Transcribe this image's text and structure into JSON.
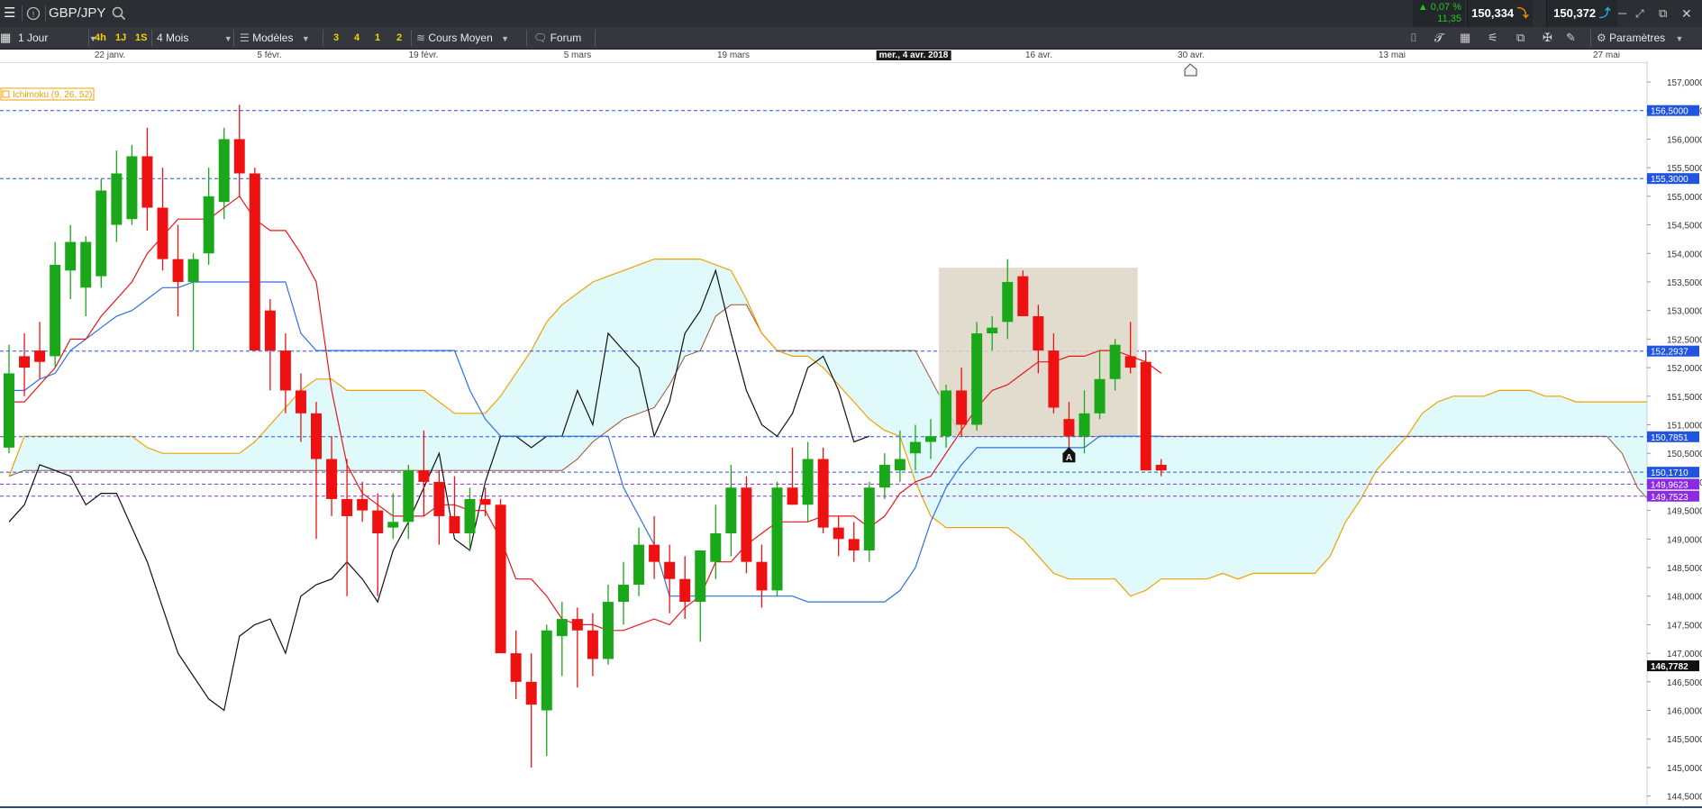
{
  "header": {
    "menu_icon": "hamburger-icon",
    "info_icon": "info-circle-icon",
    "instrument": "GBP/JPY",
    "search_icon": "search-icon",
    "change_pct": "▲ 0,07 %",
    "change_abs": "11,35",
    "sell_price": "150,334",
    "buy_price": "150,372",
    "window_icons": [
      "minimize-icon",
      "shrink-icon",
      "external-window-icon",
      "close-icon"
    ]
  },
  "toolbar": {
    "timeframe": "1 Jour",
    "intervals": [
      "4h",
      "1J",
      "1S"
    ],
    "period": "4 Mois",
    "models_label": "Modèles",
    "layouts": [
      "3",
      "4",
      "1",
      "2"
    ],
    "price_type": "Cours Moyen",
    "forum_label": "Forum",
    "settings_label": "Paramètres"
  },
  "colors": {
    "up": "#1aa81a",
    "down": "#ee1111",
    "tenkan": "#e8161b",
    "kijun": "#2f6fe0",
    "chikou": "#111111",
    "span_a": "#a0522d",
    "span_b": "#f0a000",
    "cloud": "#e0fafc",
    "hline": "#2255dd"
  },
  "chart_data": {
    "type": "candlestick",
    "indicator_label": "Ichimoku (9, 26, 52)",
    "date_labels": [
      "22 janv.",
      "5 févr.",
      "19 févr.",
      "5 mars",
      "19 mars",
      "mer., 4 avr. 2018",
      "16 avr.",
      "30 avr.",
      "13 mai",
      "27 mai"
    ],
    "ylim": [
      144.4,
      157.3
    ],
    "y_ticks": [
      "157,0000",
      "156,5000",
      "156,0000",
      "155,5000",
      "155,0000",
      "154,5000",
      "154,0000",
      "153,5000",
      "153,0000",
      "152,5000",
      "152,0000",
      "151,5000",
      "151,0000",
      "150,5000",
      "150,0000",
      "149,5000",
      "149,0000",
      "148,5000",
      "148,0000",
      "147,5000",
      "147,0000",
      "146,5000",
      "146,0000",
      "145,5000",
      "145,0000",
      "144,5000"
    ],
    "horizontal_levels": [
      {
        "value": 156.5,
        "label": "156,5000",
        "color": "#2255dd"
      },
      {
        "value": 155.31,
        "label": "155,3000",
        "color": "#2255dd"
      },
      {
        "value": 152.29,
        "label": "152,2937",
        "color": "#2255dd"
      },
      {
        "value": 150.79,
        "label": "150,7851",
        "color": "#2255dd"
      },
      {
        "value": 150.17,
        "label": "150,1710",
        "color": "#2255dd"
      },
      {
        "value": 149.96,
        "label": "149,9623",
        "color": "#8a2be2"
      },
      {
        "value": 149.75,
        "label": "149,7523",
        "color": "#8a2be2"
      }
    ],
    "current_price_label": "146,7782",
    "current_price": 146.78,
    "marker_label": "A",
    "candles": [
      {
        "o": 150.6,
        "h": 152.4,
        "l": 150.5,
        "c": 151.9
      },
      {
        "o": 152.2,
        "h": 152.6,
        "l": 151.5,
        "c": 152.0
      },
      {
        "o": 152.3,
        "h": 152.8,
        "l": 151.8,
        "c": 152.1
      },
      {
        "o": 152.2,
        "h": 154.2,
        "l": 152.0,
        "c": 153.8
      },
      {
        "o": 153.7,
        "h": 154.5,
        "l": 153.2,
        "c": 154.2
      },
      {
        "o": 153.4,
        "h": 154.3,
        "l": 152.9,
        "c": 154.2
      },
      {
        "o": 153.6,
        "h": 155.3,
        "l": 153.4,
        "c": 155.1
      },
      {
        "o": 154.5,
        "h": 155.8,
        "l": 154.2,
        "c": 155.4
      },
      {
        "o": 154.6,
        "h": 155.9,
        "l": 154.5,
        "c": 155.7
      },
      {
        "o": 155.7,
        "h": 156.2,
        "l": 154.4,
        "c": 154.8
      },
      {
        "o": 154.8,
        "h": 155.5,
        "l": 153.7,
        "c": 153.9
      },
      {
        "o": 153.9,
        "h": 154.5,
        "l": 152.9,
        "c": 153.5
      },
      {
        "o": 153.5,
        "h": 154.0,
        "l": 152.3,
        "c": 153.9
      },
      {
        "o": 154.0,
        "h": 155.5,
        "l": 153.8,
        "c": 155.0
      },
      {
        "o": 154.9,
        "h": 156.2,
        "l": 154.6,
        "c": 156.0
      },
      {
        "o": 156.0,
        "h": 156.6,
        "l": 155.0,
        "c": 155.4
      },
      {
        "o": 155.4,
        "h": 155.5,
        "l": 152.3,
        "c": 152.3
      },
      {
        "o": 153.0,
        "h": 153.2,
        "l": 151.6,
        "c": 152.3
      },
      {
        "o": 152.3,
        "h": 152.6,
        "l": 151.2,
        "c": 151.6
      },
      {
        "o": 151.6,
        "h": 151.9,
        "l": 150.7,
        "c": 151.2
      },
      {
        "o": 151.2,
        "h": 151.4,
        "l": 149.0,
        "c": 150.4
      },
      {
        "o": 150.4,
        "h": 150.8,
        "l": 149.4,
        "c": 149.7
      },
      {
        "o": 149.7,
        "h": 150.4,
        "l": 148.0,
        "c": 149.4
      },
      {
        "o": 149.7,
        "h": 150.0,
        "l": 149.3,
        "c": 149.5
      },
      {
        "o": 149.5,
        "h": 149.8,
        "l": 148.0,
        "c": 149.1
      },
      {
        "o": 149.2,
        "h": 149.8,
        "l": 149.0,
        "c": 149.3
      },
      {
        "o": 149.3,
        "h": 150.3,
        "l": 149.0,
        "c": 150.2
      },
      {
        "o": 150.2,
        "h": 150.9,
        "l": 149.4,
        "c": 150.0
      },
      {
        "o": 150.0,
        "h": 150.2,
        "l": 148.9,
        "c": 149.4
      },
      {
        "o": 149.4,
        "h": 150.1,
        "l": 149.3,
        "c": 149.1
      },
      {
        "o": 149.1,
        "h": 149.9,
        "l": 148.8,
        "c": 149.7
      },
      {
        "o": 149.7,
        "h": 149.9,
        "l": 149.4,
        "c": 149.6
      },
      {
        "o": 149.6,
        "h": 149.7,
        "l": 147.3,
        "c": 147.0
      },
      {
        "o": 147.0,
        "h": 147.4,
        "l": 146.2,
        "c": 146.5
      },
      {
        "o": 146.5,
        "h": 147.0,
        "l": 145.0,
        "c": 146.1
      },
      {
        "o": 146.0,
        "h": 147.5,
        "l": 145.2,
        "c": 147.4
      },
      {
        "o": 147.3,
        "h": 147.9,
        "l": 146.6,
        "c": 147.6
      },
      {
        "o": 147.6,
        "h": 147.8,
        "l": 146.4,
        "c": 147.4
      },
      {
        "o": 147.4,
        "h": 147.7,
        "l": 146.6,
        "c": 146.9
      },
      {
        "o": 146.9,
        "h": 148.2,
        "l": 146.8,
        "c": 147.9
      },
      {
        "o": 147.9,
        "h": 148.6,
        "l": 147.5,
        "c": 148.2
      },
      {
        "o": 148.2,
        "h": 149.2,
        "l": 148.0,
        "c": 148.9
      },
      {
        "o": 148.9,
        "h": 149.4,
        "l": 148.3,
        "c": 148.6
      },
      {
        "o": 148.6,
        "h": 148.9,
        "l": 147.7,
        "c": 148.3
      },
      {
        "o": 148.3,
        "h": 148.7,
        "l": 147.6,
        "c": 147.9
      },
      {
        "o": 147.9,
        "h": 148.8,
        "l": 147.2,
        "c": 148.8
      },
      {
        "o": 148.6,
        "h": 149.6,
        "l": 148.3,
        "c": 149.1
      },
      {
        "o": 149.1,
        "h": 150.3,
        "l": 148.7,
        "c": 149.9
      },
      {
        "o": 149.9,
        "h": 150.1,
        "l": 148.4,
        "c": 148.6
      },
      {
        "o": 148.6,
        "h": 148.9,
        "l": 147.8,
        "c": 148.1
      },
      {
        "o": 148.1,
        "h": 150.0,
        "l": 148.0,
        "c": 149.9
      },
      {
        "o": 149.9,
        "h": 150.6,
        "l": 149.6,
        "c": 149.6
      },
      {
        "o": 149.6,
        "h": 150.7,
        "l": 149.3,
        "c": 150.4
      },
      {
        "o": 150.4,
        "h": 150.6,
        "l": 149.1,
        "c": 149.2
      },
      {
        "o": 149.2,
        "h": 149.4,
        "l": 148.7,
        "c": 149.0
      },
      {
        "o": 149.0,
        "h": 149.3,
        "l": 148.6,
        "c": 148.8
      },
      {
        "o": 148.8,
        "h": 150.0,
        "l": 148.6,
        "c": 149.9
      },
      {
        "o": 149.9,
        "h": 150.5,
        "l": 149.7,
        "c": 150.3
      },
      {
        "o": 150.2,
        "h": 150.9,
        "l": 150.0,
        "c": 150.4
      },
      {
        "o": 150.5,
        "h": 151.0,
        "l": 150.2,
        "c": 150.7
      },
      {
        "o": 150.7,
        "h": 151.1,
        "l": 150.4,
        "c": 150.8
      },
      {
        "o": 150.8,
        "h": 151.7,
        "l": 150.6,
        "c": 151.6
      },
      {
        "o": 151.6,
        "h": 152.0,
        "l": 150.8,
        "c": 151.0
      },
      {
        "o": 151.0,
        "h": 152.8,
        "l": 150.9,
        "c": 152.6
      },
      {
        "o": 152.6,
        "h": 152.9,
        "l": 152.3,
        "c": 152.7
      },
      {
        "o": 152.8,
        "h": 153.9,
        "l": 152.5,
        "c": 153.5
      },
      {
        "o": 153.6,
        "h": 153.7,
        "l": 152.9,
        "c": 152.9
      },
      {
        "o": 152.9,
        "h": 153.1,
        "l": 151.9,
        "c": 152.3
      },
      {
        "o": 152.3,
        "h": 152.6,
        "l": 151.2,
        "c": 151.3
      },
      {
        "o": 151.1,
        "h": 151.4,
        "l": 150.5,
        "c": 150.8
      },
      {
        "o": 150.8,
        "h": 151.6,
        "l": 150.5,
        "c": 151.2
      },
      {
        "o": 151.2,
        "h": 152.3,
        "l": 151.1,
        "c": 151.8
      },
      {
        "o": 151.8,
        "h": 152.5,
        "l": 151.6,
        "c": 152.4
      },
      {
        "o": 152.2,
        "h": 152.8,
        "l": 151.9,
        "c": 152.0
      },
      {
        "o": 152.1,
        "h": 152.3,
        "l": 151.7,
        "c": 150.2
      },
      {
        "o": 150.3,
        "h": 150.4,
        "l": 150.1,
        "c": 150.2
      }
    ],
    "tenkan": [
      151.4,
      151.4,
      151.7,
      152.0,
      152.5,
      152.5,
      152.9,
      153.2,
      153.5,
      154.0,
      154.3,
      154.6,
      154.6,
      154.6,
      154.8,
      155.0,
      154.6,
      154.4,
      154.4,
      154.0,
      153.5,
      151.6,
      150.3,
      149.8,
      149.6,
      149.4,
      149.4,
      149.4,
      149.6,
      149.6,
      149.5,
      149.5,
      149.0,
      148.3,
      148.3,
      148.0,
      147.6,
      147.5,
      147.5,
      147.4,
      147.4,
      147.5,
      147.6,
      147.5,
      147.8,
      148.0,
      148.6,
      148.6,
      148.9,
      149.1,
      149.3,
      149.3,
      149.3,
      149.4,
      149.4,
      149.4,
      149.2,
      149.4,
      149.8,
      150.0,
      150.1,
      150.5,
      150.9,
      151.3,
      151.6,
      151.7,
      151.9,
      152.1,
      152.1,
      152.2,
      152.2,
      152.3,
      152.3,
      152.2,
      152.1,
      151.9
    ],
    "kijun": [
      151.6,
      151.6,
      151.8,
      151.9,
      152.3,
      152.5,
      152.7,
      152.9,
      153.0,
      153.2,
      153.4,
      153.4,
      153.5,
      153.5,
      153.5,
      153.5,
      153.5,
      153.5,
      153.5,
      152.6,
      152.3,
      152.3,
      152.3,
      152.3,
      152.3,
      152.3,
      152.3,
      152.3,
      152.3,
      152.3,
      151.6,
      151.1,
      150.8,
      150.8,
      150.8,
      150.8,
      150.8,
      150.8,
      150.8,
      150.8,
      149.9,
      149.4,
      148.9,
      148.0,
      148.0,
      148.0,
      148.0,
      148.0,
      148.0,
      148.0,
      148.0,
      148.0,
      147.9,
      147.9,
      147.9,
      147.9,
      147.9,
      147.9,
      148.1,
      148.5,
      149.3,
      149.9,
      150.3,
      150.6,
      150.6,
      150.6,
      150.6,
      150.6,
      150.6,
      150.6,
      150.6,
      150.8,
      150.8,
      150.8,
      150.8,
      150.8
    ],
    "chikou": [
      149.3,
      149.6,
      150.3,
      150.2,
      150.1,
      149.6,
      149.8,
      149.8,
      149.2,
      148.6,
      147.8,
      147.0,
      146.6,
      146.2,
      146.0,
      147.3,
      147.5,
      147.6,
      147.0,
      148.0,
      148.2,
      148.3,
      148.6,
      148.3,
      147.9,
      148.8,
      149.3,
      149.9,
      150.5,
      149.0,
      148.8,
      150.0,
      150.8,
      150.8,
      150.6,
      150.8,
      150.8,
      151.6,
      151.0,
      152.6,
      152.3,
      152.0,
      150.8,
      151.4,
      152.6,
      153.0,
      153.7,
      152.6,
      151.6,
      151.0,
      150.8,
      151.2,
      152.0,
      152.2,
      151.6,
      150.7,
      150.8
    ],
    "span_a": [
      150.1,
      150.2,
      150.2,
      150.2,
      150.2,
      150.2,
      150.2,
      150.2,
      150.2,
      150.2,
      150.2,
      150.2,
      150.2,
      150.2,
      150.2,
      150.2,
      150.2,
      150.2,
      150.2,
      150.2,
      150.2,
      150.2,
      150.2,
      150.2,
      150.2,
      150.2,
      150.2,
      150.2,
      150.2,
      150.2,
      150.2,
      150.2,
      150.2,
      150.2,
      150.2,
      150.2,
      150.2,
      150.4,
      150.7,
      150.9,
      151.1,
      151.2,
      151.3,
      151.7,
      152.2,
      152.3,
      152.9,
      153.1,
      153.1,
      152.6,
      152.3,
      152.3,
      152.3,
      152.3,
      152.3,
      152.3,
      152.3,
      152.3,
      152.3,
      152.3,
      151.8,
      151.3,
      150.8,
      150.8,
      150.8,
      150.8,
      150.8,
      150.8,
      150.8,
      150.8,
      150.8,
      150.8,
      150.8,
      150.8,
      150.8,
      150.8,
      150.8,
      150.8,
      150.8,
      150.8,
      150.8,
      150.8,
      150.8,
      150.8,
      150.8,
      150.8,
      150.8,
      150.8,
      150.8,
      150.8,
      150.8,
      150.8,
      150.8,
      150.8,
      150.8,
      150.8,
      150.8,
      150.8,
      150.8,
      150.8,
      150.8,
      150.8,
      150.8,
      150.8,
      150.8,
      150.5,
      149.9,
      149.6,
      149.6,
      149.6,
      149.6,
      149.6,
      149.6,
      149.6
    ],
    "span_b": [
      150.1,
      150.8,
      150.8,
      150.8,
      150.8,
      150.8,
      150.8,
      150.8,
      150.8,
      150.6,
      150.5,
      150.5,
      150.5,
      150.5,
      150.5,
      150.5,
      150.7,
      151.0,
      151.3,
      151.6,
      151.8,
      151.8,
      151.6,
      151.6,
      151.6,
      151.6,
      151.6,
      151.6,
      151.4,
      151.2,
      151.2,
      151.2,
      151.5,
      151.9,
      152.3,
      152.8,
      153.1,
      153.3,
      153.5,
      153.6,
      153.7,
      153.8,
      153.9,
      153.9,
      153.9,
      153.9,
      153.8,
      153.7,
      153.2,
      152.6,
      152.3,
      152.2,
      152.2,
      152.0,
      151.7,
      151.4,
      151.1,
      150.9,
      150.8,
      150.0,
      149.4,
      149.2,
      149.2,
      149.2,
      149.2,
      149.2,
      149.0,
      148.7,
      148.4,
      148.3,
      148.3,
      148.3,
      148.3,
      148.0,
      148.1,
      148.3,
      148.3,
      148.3,
      148.3,
      148.4,
      148.3,
      148.4,
      148.4,
      148.4,
      148.4,
      148.4,
      148.7,
      149.3,
      149.7,
      150.2,
      150.5,
      150.8,
      151.2,
      151.4,
      151.5,
      151.5,
      151.5,
      151.6,
      151.6,
      151.6,
      151.5,
      151.5,
      151.4,
      151.4,
      151.4,
      151.4,
      151.4,
      151.4,
      151.4,
      151.4,
      151.4,
      151.4,
      151.4,
      151.4
    ]
  }
}
